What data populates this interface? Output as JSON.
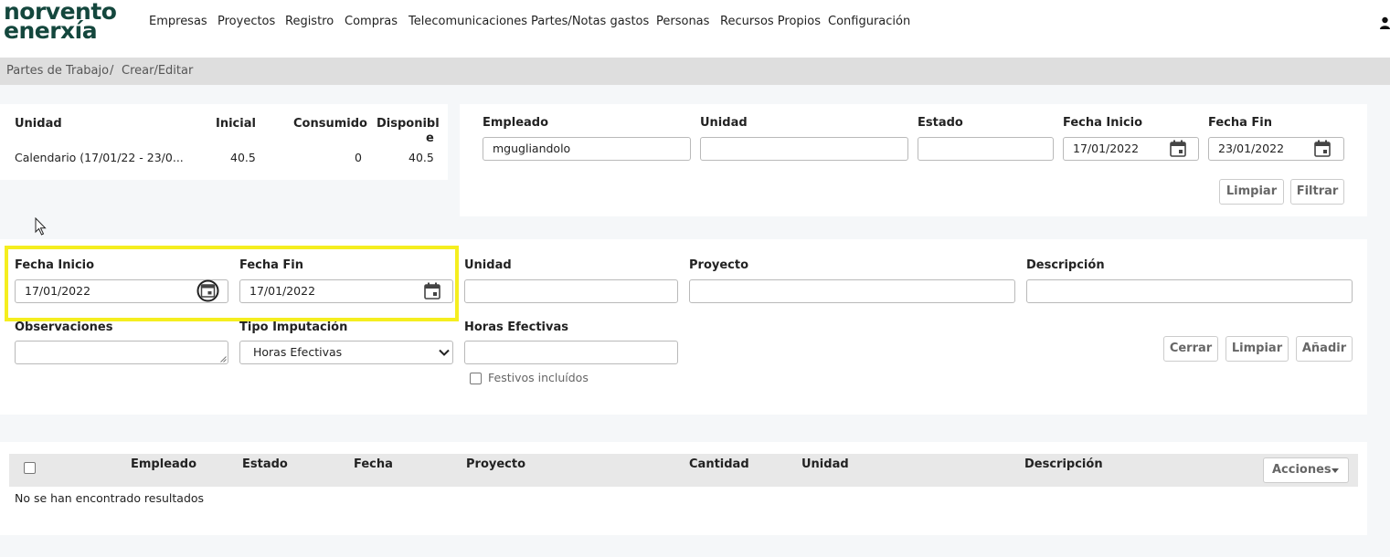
{
  "brand": {
    "line1": "norvento",
    "line2": "enerxía"
  },
  "nav": {
    "items": [
      "Empresas",
      "Proyectos",
      "Registro",
      "Compras",
      "Telecomunicaciones",
      "Partes/Notas gastos",
      "Personas",
      "Recursos Propios",
      "Configuración"
    ]
  },
  "breadcrumb": {
    "items": [
      "Partes de Trabajo",
      "Crear/Editar"
    ],
    "separator": "/"
  },
  "balance": {
    "headers": {
      "unidad": "Unidad",
      "inicial": "Inicial",
      "consumido": "Consumido",
      "disponible_l1": "Disponibl",
      "disponible_l2": "e"
    },
    "row": {
      "unidad": "Calendario (17/01/22 - 23/0...",
      "inicial": "40.5",
      "consumido": "0",
      "disponible": "40.5"
    }
  },
  "filter": {
    "empleado_label": "Empleado",
    "empleado_value": "mgugliandolo",
    "unidad_label": "Unidad",
    "unidad_value": "",
    "estado_label": "Estado",
    "estado_value": "",
    "fecha_inicio_label": "Fecha Inicio",
    "fecha_inicio_value": "17/01/2022",
    "fecha_fin_label": "Fecha Fin",
    "fecha_fin_value": "23/01/2022",
    "limpiar": "Limpiar",
    "filtrar": "Filtrar"
  },
  "form": {
    "fecha_inicio_label": "Fecha Inicio",
    "fecha_inicio_value": "17/01/2022",
    "fecha_fin_label": "Fecha Fin",
    "fecha_fin_value": "17/01/2022",
    "unidad_label": "Unidad",
    "unidad_value": "",
    "proyecto_label": "Proyecto",
    "proyecto_value": "",
    "descripcion_label": "Descripción",
    "descripcion_value": "",
    "observaciones_label": "Observaciones",
    "observaciones_value": "",
    "tipo_label": "Tipo Imputación",
    "tipo_value": "Horas Efectivas",
    "horas_label": "Horas Efectivas",
    "horas_value": "",
    "festivos_label": "Festivos incluídos",
    "cerrar": "Cerrar",
    "limpiar": "Limpiar",
    "anadir": "Añadir"
  },
  "table": {
    "columns": [
      "Empleado",
      "Estado",
      "Fecha",
      "Proyecto",
      "Cantidad",
      "Unidad",
      "Descripción"
    ],
    "acciones": "Acciones",
    "empty": "No se han encontrado resultados"
  },
  "colors": {
    "brand": "#14473d",
    "highlight": "#f5ee1f"
  }
}
